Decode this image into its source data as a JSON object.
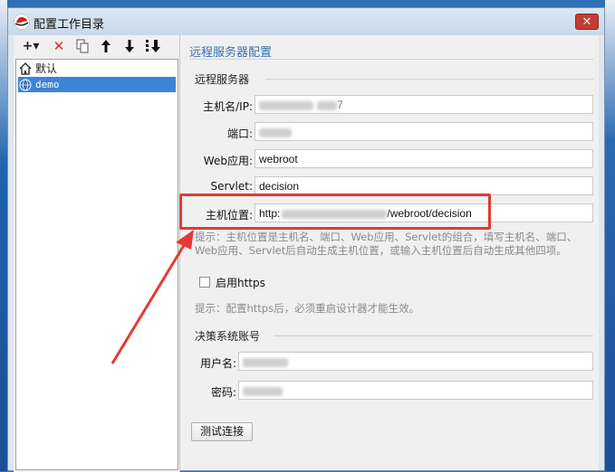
{
  "window": {
    "title": "配置工作目录",
    "close_label": "✕"
  },
  "toolbar": {
    "add_label": "+▾",
    "delete_label": "✕"
  },
  "tree": {
    "items": [
      {
        "label": "默认",
        "icon": "home-icon",
        "selected": false
      },
      {
        "label": "demo",
        "icon": "globe-icon",
        "selected": true
      }
    ]
  },
  "main": {
    "section_title": "远程服务器配置",
    "server_group": "远程服务器",
    "host_label": "主机名/IP:",
    "host_value_suffix": "7",
    "port_label": "端口:",
    "webapp_label": "Web应用:",
    "webapp_value": "webroot",
    "servlet_label": "Servlet:",
    "servlet_value": "decision",
    "location_label": "主机位置:",
    "location_prefix": "http:",
    "location_suffix": "/webroot/decision",
    "hint1": "提示：主机位置是主机名、端口、Web应用、Servlet的组合，填写主机名、端口、Web应用、Servlet后自动生成主机位置，或输入主机位置后自动生成其他四项。",
    "https_label": "启用https",
    "hint2": "提示：配置https后，必须重启设计器才能生效。",
    "account_group": "决策系统账号",
    "username_label": "用户名:",
    "password_label": "密码:",
    "test_button": "测试连接"
  },
  "colors": {
    "accent": "#3570b0",
    "selection": "#3b85d4",
    "annotation": "#e53935"
  }
}
